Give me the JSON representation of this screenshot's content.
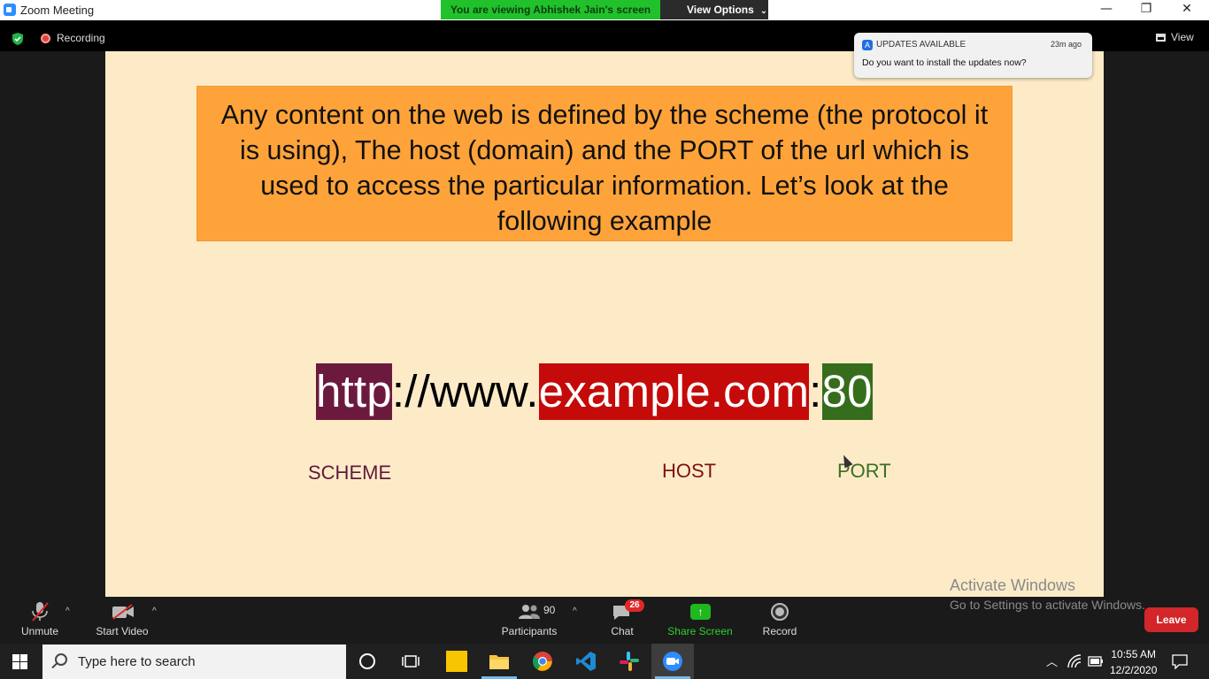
{
  "window": {
    "title": "Zoom Meeting",
    "viewing_banner": "You are viewing Abhishek Jain's screen",
    "view_options_label": "View Options",
    "minimize_glyph": "—",
    "restore_glyph": "❐",
    "close_glyph": "✕"
  },
  "top": {
    "recording_label": "Recording",
    "view_label": "View"
  },
  "notification": {
    "header": "UPDATES AVAILABLE",
    "time": "23m ago",
    "body": "Do you want to install the updates now?"
  },
  "slide": {
    "paragraph": "Any content on the web is defined by the scheme (the protocol it is using), The host (domain) and the PORT of the url which is used to access the particular information. Let’s look at the following example",
    "url_scheme": "http",
    "url_middle": "://www.",
    "url_host": "example.com",
    "url_colon": ":",
    "url_port": "80",
    "label_scheme": "SCHEME",
    "label_host": "HOST",
    "label_port": "PORT",
    "colors": {
      "background": "#fdebc8",
      "box": "#fea33a",
      "scheme": "#6b1a3e",
      "host": "#c50a0a",
      "port": "#356d1c"
    }
  },
  "watermark": {
    "line1": "Activate Windows",
    "line2": "Go to Settings to activate Windows."
  },
  "toolbar": {
    "unmute": "Unmute",
    "start_video": "Start Video",
    "participants": "Participants",
    "participants_count": "90",
    "chat": "Chat",
    "chat_badge": "26",
    "share_screen": "Share Screen",
    "record": "Record",
    "leave": "Leave",
    "caret": "^"
  },
  "taskbar": {
    "search_placeholder": "Type here to search",
    "time": "10:55 AM",
    "date": "12/2/2020",
    "icons": [
      "cortana-icon",
      "task-view-icon",
      "sticky-notes-icon",
      "file-explorer-icon",
      "chrome-icon",
      "vscode-icon",
      "slack-icon",
      "zoom-icon"
    ]
  }
}
